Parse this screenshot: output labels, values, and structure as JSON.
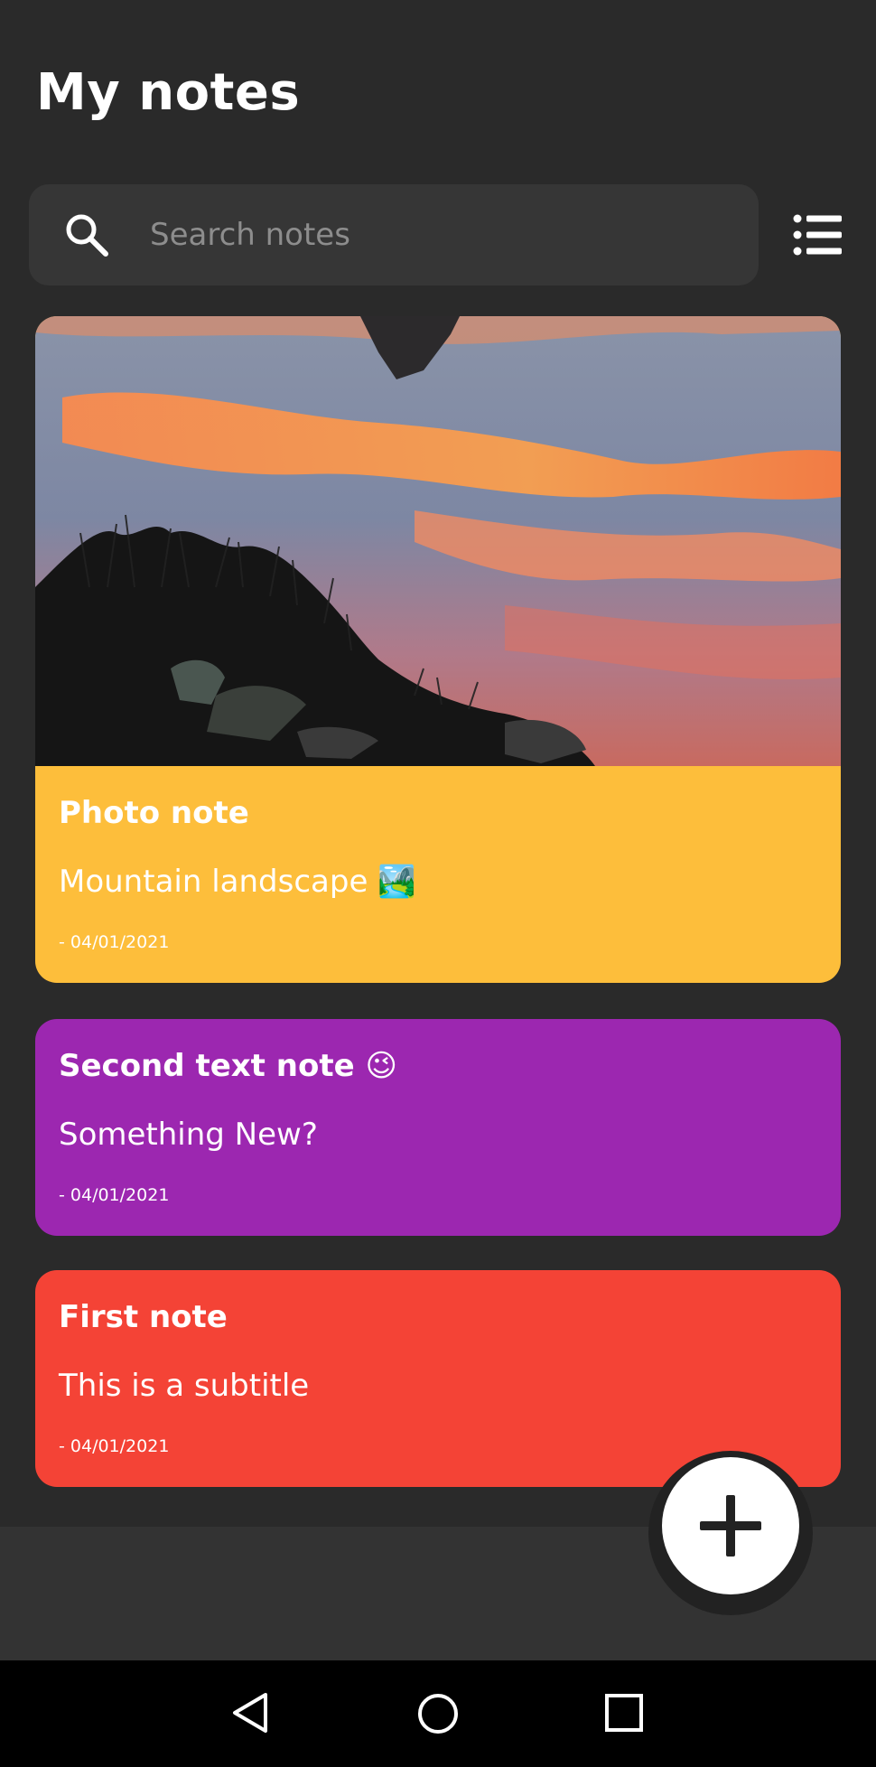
{
  "header": {
    "title": "My notes"
  },
  "search": {
    "placeholder": "Search notes",
    "value": "",
    "icon": "search-icon"
  },
  "toolbar": {
    "view_toggle_icon": "list-icon"
  },
  "notes": [
    {
      "title": "Photo note",
      "subtitle": "Mountain landscape 🏞️",
      "date": "- 04/01/2021",
      "color": "#fdbe3b",
      "has_image": true,
      "image_description": "sunset sky reflected in water with grassy rocky shore"
    },
    {
      "title": "Second text note 😉",
      "subtitle": "Something New?",
      "date": "- 04/01/2021",
      "color": "#9c27b0",
      "has_image": false
    },
    {
      "title": "First note",
      "subtitle": "This is a subtitle",
      "date": "- 04/01/2021",
      "color": "#f44336",
      "has_image": false
    }
  ],
  "fab": {
    "icon": "plus-icon"
  },
  "system_nav": {
    "back_icon": "back-triangle-icon",
    "home_icon": "home-circle-icon",
    "recents_icon": "recents-square-icon"
  },
  "colors": {
    "background": "#2a2a2a",
    "search_background": "#363636",
    "bottom_bar": "#333333",
    "fab": "#ffffff"
  }
}
